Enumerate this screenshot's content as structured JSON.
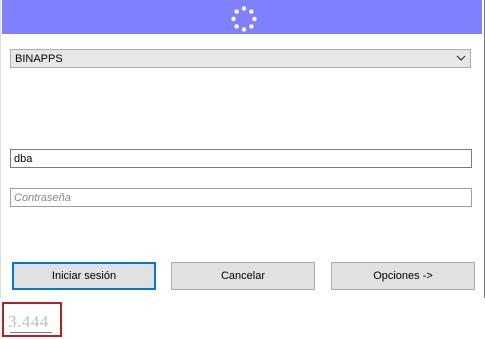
{
  "header": {
    "background_color": "#8080ff",
    "spinner_icon": "loading-spinner-icon"
  },
  "connection": {
    "selected": "BINAPPS",
    "dropdown_icon": "chevron-down-icon"
  },
  "username": {
    "value": "dba"
  },
  "password": {
    "value": "",
    "placeholder": "Contraseña"
  },
  "buttons": {
    "login_label": "Iniciar sesión",
    "cancel_label": "Cancelar",
    "options_label": "Opciones ->"
  },
  "version": {
    "text": "3.444",
    "highlight_color": "#b22222"
  }
}
